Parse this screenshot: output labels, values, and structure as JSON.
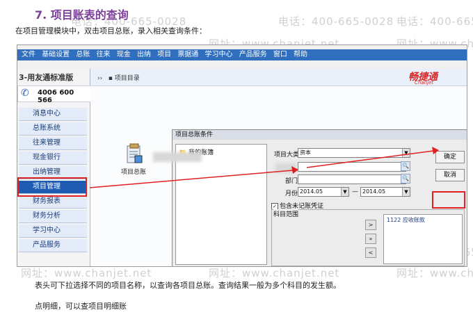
{
  "page": {
    "heading": "7. 项目账表的查询",
    "intro": "在项目管理模块中，双击项目总账，录入相关查询条件：",
    "body_line1": "表头可下拉选择不同的项目名称，以查询各项目总账。查询结果一般为多个科目的发生额。",
    "body_line2": "点明细，可以查项目明细账"
  },
  "watermark": {
    "phone": "电话：400-665-0028",
    "site": "网址：www.chanjet.net"
  },
  "menubar": [
    "文件",
    "基础设置",
    "总账",
    "往来",
    "现金",
    "出纳",
    "项目",
    "票据通",
    "学习中心",
    "产品服务",
    "窗口",
    "帮助"
  ],
  "sidebar": {
    "brand": "3-用友通标准版",
    "phone": "4006 600 566",
    "items": [
      "消息中心",
      "总账系统",
      "往来管理",
      "现金银行",
      "出纳管理",
      "项目管理",
      "财务报表",
      "财务分析",
      "学习中心",
      "产品服务"
    ],
    "active_index": 5
  },
  "topstrip": {
    "breadcrumb": "项目目录",
    "logo": "畅捷通",
    "logo_sub": "Chanjet"
  },
  "desktop": {
    "icon_label": "项目总账",
    "icon": "ledger-icon"
  },
  "dialog": {
    "title": "项目总账条件",
    "tree_root": "我的账簿",
    "project_major_label": "项目大类",
    "project_major_value": "资本",
    "dept_label": "部门",
    "month_label": "月份",
    "month_from": "2014.05",
    "month_sep": "—",
    "month_to": "2014.05",
    "include_unposted": "包含未记账凭证",
    "scope_label": "科目范围",
    "subject_item": "1122 应收账款",
    "ok": "确定",
    "cancel": "取消"
  },
  "colors": {
    "heading": "#7b3f99",
    "highlight": "#e02020",
    "menubar": "#2f6fbe",
    "nav_active": "#1e5cb3"
  }
}
